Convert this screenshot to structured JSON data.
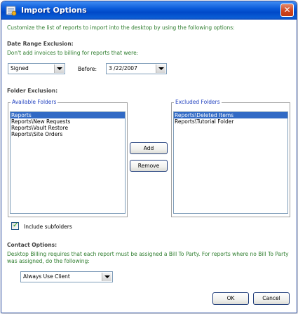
{
  "window": {
    "title": "Import Options",
    "close_symbol": "✕"
  },
  "intro": "Customize the list of reports to import into the desktop by using the following options:",
  "date_range": {
    "heading": "Date Range Exclusion:",
    "description": "Don't add invoices to billing for reports that were:",
    "status_value": "Signed",
    "before_label": "Before:",
    "before_date": "3 /22/2007"
  },
  "folder_exclusion": {
    "heading": "Folder Exclusion:",
    "available": {
      "title": "Available Folders",
      "items": [
        "Reports",
        "Reports\\New Requests",
        "Reports\\Vault Restore",
        "Reports\\Site Orders"
      ],
      "selected_index": 0
    },
    "excluded": {
      "title": "Excluded Folders",
      "items": [
        "Reports\\Deleted Items",
        "Reports\\Tutorial Folder"
      ],
      "selected_index": 0
    },
    "add_label": "Add",
    "remove_label": "Remove",
    "include_subfolders_label": "Include subfolders",
    "include_subfolders_checked": true
  },
  "contact": {
    "heading": "Contact Options:",
    "description_line1": "Desktop Billing requires that each report must be assigned a Bill To Party. For reports where no Bill To Party",
    "description_line2": "was assigned, do the following:",
    "option_value": "Always Use Client"
  },
  "footer": {
    "ok_label": "OK",
    "cancel_label": "Cancel"
  },
  "colors": {
    "titlebar": "#0a5bd9",
    "green_text": "#2e7d2e",
    "group_title": "#1f3fbf",
    "selection": "#316ac5"
  }
}
